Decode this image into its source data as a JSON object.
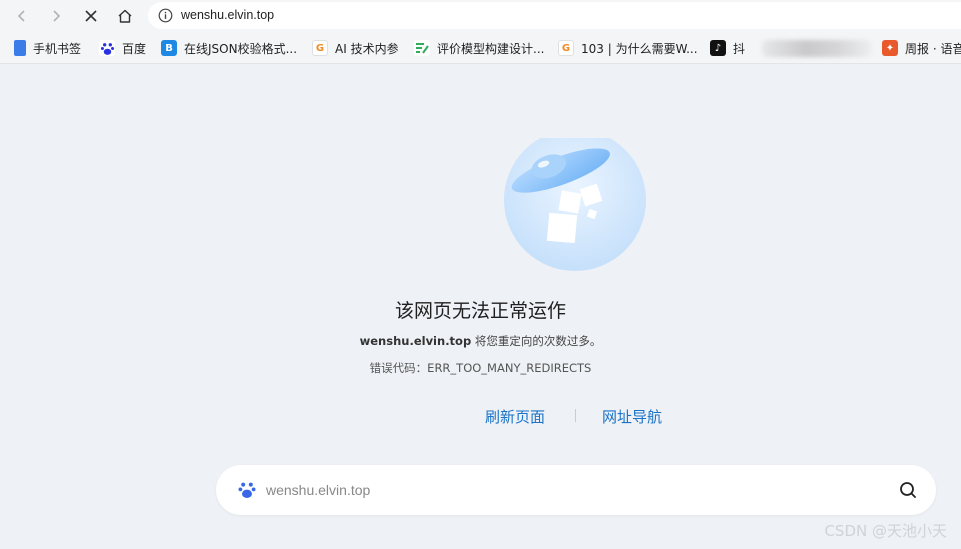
{
  "browser": {
    "url": "wenshu.elvin.top",
    "icons": {
      "back": "back-arrow-icon",
      "forward": "forward-arrow-icon",
      "stop": "stop-loading-icon",
      "home": "home-icon",
      "site_info": "info-icon"
    }
  },
  "bookmarks": [
    {
      "label": "手机书签",
      "icon": "phone-bookmark-icon",
      "color": "#3b7de8"
    },
    {
      "label": "百度",
      "icon": "baidu-icon",
      "color": "#2932e1"
    },
    {
      "label": "在线JSON校验格式...",
      "icon": "json-icon",
      "color": "#1e88e5"
    },
    {
      "label": "AI 技术内参",
      "icon": "geektime-icon",
      "color": "#f08a24"
    },
    {
      "label": "评价模型构建设计...",
      "icon": "doc-icon",
      "color": "#2eae5a"
    },
    {
      "label": "103 | 为什么需要W...",
      "icon": "geektime-icon",
      "color": "#f08a24"
    },
    {
      "label": "抖",
      "icon": "tiktok-icon",
      "color": "#111111"
    },
    {
      "label": "周报 · 语音",
      "icon": "weekly-icon",
      "color": "#e85a2c"
    }
  ],
  "error": {
    "title": "该网页无法正常运作",
    "host": "wenshu.elvin.top",
    "description": "将您重定向的次数过多。",
    "code_label": "错误代码：",
    "code": "ERR_TOO_MANY_REDIRECTS",
    "reload_label": "刷新页面",
    "nav_label": "网址导航"
  },
  "search": {
    "value": "wenshu.elvin.top",
    "engine_icon": "baidu-paw-icon",
    "button_icon": "search-icon"
  },
  "watermark": "CSDN @天池小天",
  "colors": {
    "link": "#1a73c8",
    "page_bg": "#eef1f5"
  }
}
